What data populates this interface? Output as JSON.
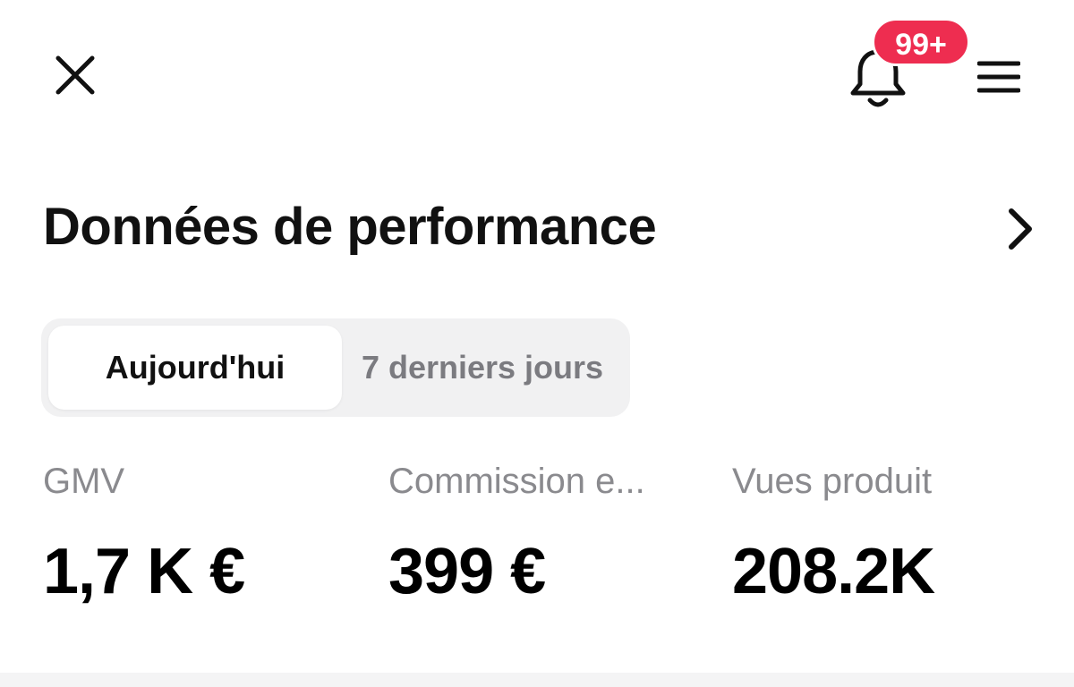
{
  "header": {
    "close_icon": "close-icon",
    "bell_icon": "bell-icon",
    "notification_badge": "99+",
    "badge_color": "#ee2d50",
    "menu_icon": "hamburger-menu-icon"
  },
  "section": {
    "title": "Données de performance",
    "chevron_icon": "chevron-right-icon"
  },
  "tabs": [
    {
      "label": "Aujourd'hui",
      "selected": true
    },
    {
      "label": "7 derniers jours",
      "selected": false
    }
  ],
  "metrics": [
    {
      "label": "GMV",
      "value": "1,7 K €"
    },
    {
      "label": "Commission e...",
      "value": "399 €"
    },
    {
      "label": "Vues produit",
      "value": "208.2K"
    }
  ]
}
